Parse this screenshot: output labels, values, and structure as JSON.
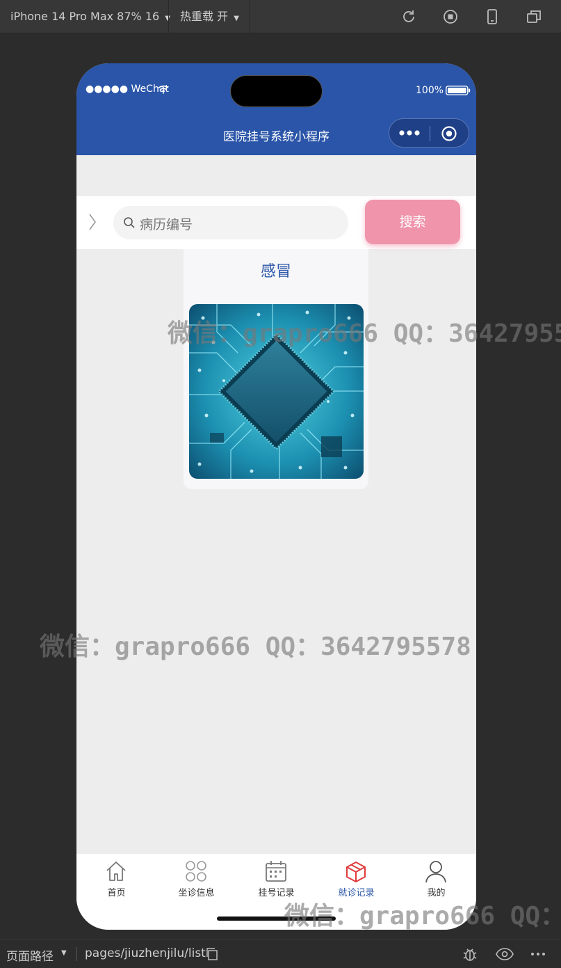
{
  "devtools": {
    "device": "iPhone 14 Pro Max 87% 16",
    "hot_reload": "热重载 开",
    "path_label": "页面路径",
    "path_value": "pages/jiuzhenjilu/list"
  },
  "status_bar": {
    "carrier": "●●●●● WeChat",
    "battery": "100%"
  },
  "nav": {
    "title": "医院挂号系统小程序"
  },
  "search": {
    "placeholder": "病历编号",
    "button_label": "搜索"
  },
  "records": [
    {
      "title": "感冒"
    }
  ],
  "tabbar": {
    "items": [
      {
        "label": "首页",
        "icon": "home-icon"
      },
      {
        "label": "坐诊信息",
        "icon": "grid-icon"
      },
      {
        "label": "挂号记录",
        "icon": "calendar-icon"
      },
      {
        "label": "就诊记录",
        "icon": "box-icon"
      },
      {
        "label": "我的",
        "icon": "user-icon"
      }
    ],
    "active_index": 3,
    "active_color": "#e03b3b",
    "active_label_color": "#2a55a8"
  },
  "watermark": {
    "text": "微信：grapro666 QQ：3642795578"
  },
  "colors": {
    "header": "#2a55a8",
    "search_button": "#ef94ab",
    "page_background": "#ededed"
  }
}
